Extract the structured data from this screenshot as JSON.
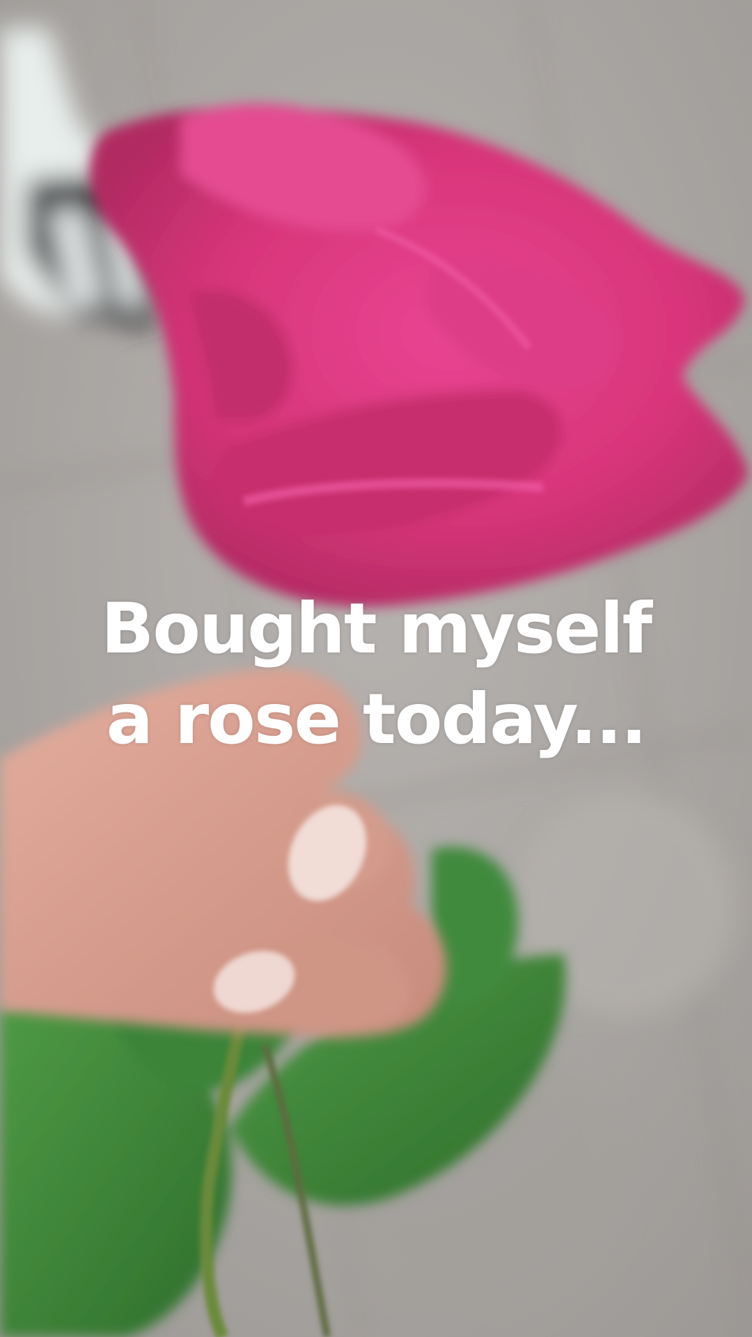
{
  "scene": {
    "subject": "hand holding a pink rose",
    "background": "blurred grey pavement",
    "colors": {
      "rose": "#d8357a",
      "rose_highlight": "#ec4f98",
      "rose_shadow": "#b5275f",
      "leaf": "#3f8a3c",
      "leaf_dark": "#2c6a2a",
      "skin": "#d8a293",
      "nail": "#f1dcd6",
      "pavement": "#a9a6a3"
    }
  },
  "caption": {
    "line1": "Bought myself",
    "line2": "a rose today..."
  }
}
